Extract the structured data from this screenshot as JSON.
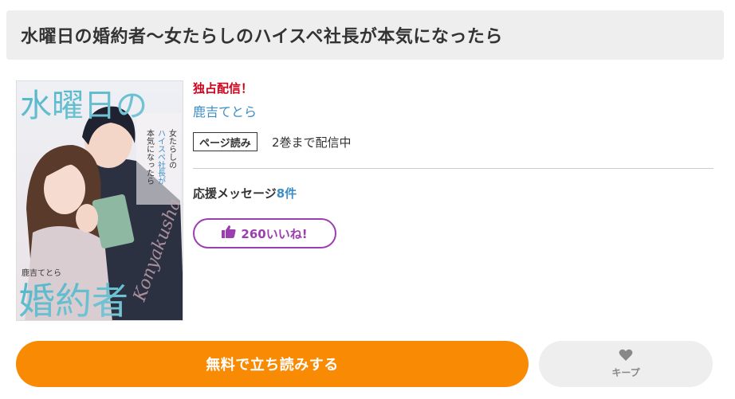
{
  "title": "水曜日の婚約者〜女たらしのハイスペ社長が本気になったら",
  "cover": {
    "title_top": "水曜日の",
    "title_bottom": "婚約者",
    "subtitle_lines": [
      "女たらしの",
      "ハイスペ社長が",
      "本気になったら"
    ],
    "author": "鹿吉てとら",
    "romaji": "Konyakusha"
  },
  "info": {
    "exclusive": "独占配信！",
    "author": "鹿吉てとら",
    "badge": "ページ読み",
    "availability": "2巻まで配信中",
    "support_label": "応援メッセージ",
    "support_count": "8件",
    "like_label": "260いいね!"
  },
  "actions": {
    "read": "無料で立ち読みする",
    "keep": "キープ"
  },
  "colors": {
    "exclusive": "#d0021b",
    "link": "#3d8ec7",
    "like": "#9b3fb0",
    "primary": "#f98a03",
    "keep_bg": "#eeeeee"
  }
}
